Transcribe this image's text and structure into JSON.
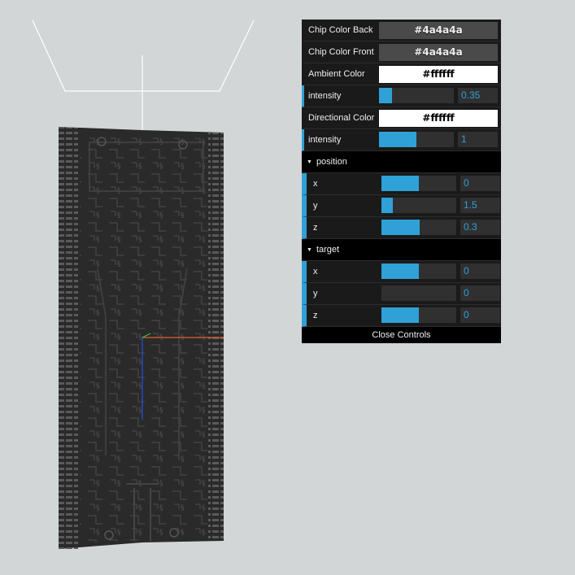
{
  "gui": {
    "controls": [
      {
        "kind": "color",
        "label": "Chip Color Back",
        "value": "#4a4a4a",
        "swatch": "#4a4a4a",
        "light": false
      },
      {
        "kind": "color",
        "label": "Chip Color Front",
        "value": "#4a4a4a",
        "swatch": "#4a4a4a",
        "light": false
      },
      {
        "kind": "color",
        "label": "Ambient Color",
        "value": "#ffffff",
        "swatch": "#ffffff",
        "light": true
      },
      {
        "kind": "number",
        "label": "intensity",
        "value": "0.35",
        "fraction": 0.17
      },
      {
        "kind": "color",
        "label": "Directional Color",
        "value": "#ffffff",
        "swatch": "#ffffff",
        "light": true
      },
      {
        "kind": "number",
        "label": "intensity",
        "value": "1",
        "fraction": 0.5
      }
    ],
    "position": {
      "title": "position",
      "x": {
        "label": "x",
        "value": "0",
        "fraction": 0.5
      },
      "y": {
        "label": "y",
        "value": "1.5",
        "fraction": 0.15
      },
      "z": {
        "label": "z",
        "value": "0.3",
        "fraction": 0.51
      }
    },
    "target": {
      "title": "target",
      "x": {
        "label": "x",
        "value": "0",
        "fraction": 0.5
      },
      "y": {
        "label": "y",
        "value": "0",
        "fraction": 0.0
      },
      "z": {
        "label": "z",
        "value": "0",
        "fraction": 0.5
      }
    },
    "close_label": "Close Controls"
  },
  "colors": {
    "accent": "#2fa1d6",
    "background": "#d3d6d6",
    "chip": "#2a2a2a"
  }
}
